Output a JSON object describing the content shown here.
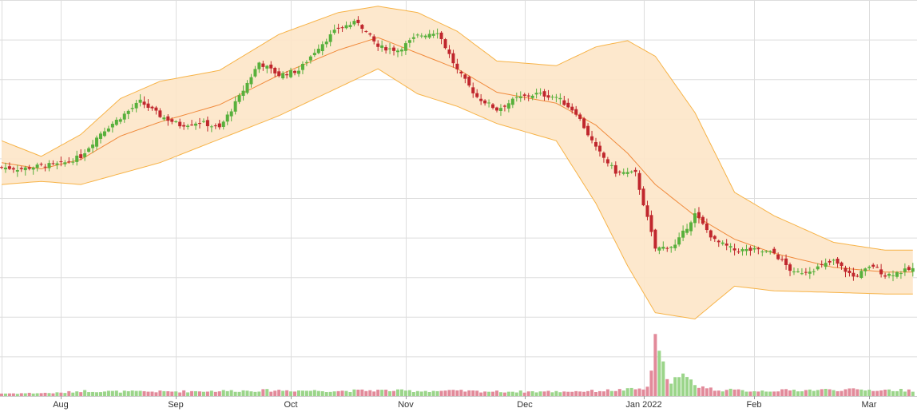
{
  "chart_data": {
    "type": "candlestick",
    "indicators": [
      "bollinger_bands",
      "moving_average",
      "volume"
    ],
    "x_tick_labels": [
      "Aug",
      "Sep",
      "Oct",
      "Nov",
      "Dec",
      "Jan 2022",
      "Feb",
      "Mar"
    ],
    "price_ylim": [
      30,
      270
    ],
    "volume_ylim": [
      0,
      100
    ],
    "grid": true,
    "legend": "none",
    "colors": {
      "up": "#58b03c",
      "down": "#c0272d",
      "band_fill": "#fde6c8",
      "band_line": "#f7b347",
      "ma_line": "#f08a3c",
      "volume_up": "#9bd58a",
      "volume_down": "#e28a9a",
      "grid": "#dddddd"
    },
    "anchors": {
      "close": [
        [
          0,
          163
        ],
        [
          5,
          162
        ],
        [
          10,
          164
        ],
        [
          15,
          165
        ],
        [
          20,
          170
        ],
        [
          25,
          185
        ],
        [
          30,
          195
        ],
        [
          35,
          205
        ],
        [
          40,
          196
        ],
        [
          45,
          190
        ],
        [
          50,
          192
        ],
        [
          55,
          188
        ],
        [
          60,
          208
        ],
        [
          65,
          230
        ],
        [
          70,
          222
        ],
        [
          75,
          225
        ],
        [
          80,
          240
        ],
        [
          85,
          252
        ],
        [
          90,
          256
        ],
        [
          95,
          240
        ],
        [
          100,
          238
        ],
        [
          105,
          247
        ],
        [
          110,
          250
        ],
        [
          115,
          225
        ],
        [
          120,
          208
        ],
        [
          125,
          200
        ],
        [
          130,
          207
        ],
        [
          135,
          210
        ],
        [
          140,
          208
        ],
        [
          145,
          198
        ],
        [
          150,
          175
        ],
        [
          155,
          160
        ],
        [
          160,
          159
        ],
        [
          165,
          111
        ],
        [
          170,
          113
        ],
        [
          175,
          133
        ],
        [
          180,
          116
        ],
        [
          185,
          110
        ],
        [
          190,
          110
        ],
        [
          195,
          108
        ],
        [
          200,
          95
        ],
        [
          205,
          98
        ],
        [
          210,
          103
        ],
        [
          215,
          93
        ],
        [
          220,
          100
        ],
        [
          223,
          94
        ],
        [
          230,
          98
        ]
      ],
      "mid": [
        [
          0,
          166
        ],
        [
          10,
          162
        ],
        [
          20,
          168
        ],
        [
          30,
          183
        ],
        [
          40,
          192
        ],
        [
          55,
          203
        ],
        [
          70,
          222
        ],
        [
          85,
          238
        ],
        [
          95,
          246
        ],
        [
          105,
          236
        ],
        [
          115,
          226
        ],
        [
          125,
          211
        ],
        [
          140,
          204
        ],
        [
          150,
          190
        ],
        [
          158,
          172
        ],
        [
          165,
          152
        ],
        [
          175,
          132
        ],
        [
          185,
          117
        ],
        [
          195,
          108
        ],
        [
          210,
          99
        ],
        [
          223,
          96
        ],
        [
          230,
          96
        ]
      ],
      "width": [
        [
          0,
          14
        ],
        [
          10,
          8
        ],
        [
          20,
          16
        ],
        [
          30,
          24
        ],
        [
          40,
          26
        ],
        [
          55,
          22
        ],
        [
          70,
          26
        ],
        [
          85,
          24
        ],
        [
          95,
          20
        ],
        [
          105,
          26
        ],
        [
          115,
          24
        ],
        [
          125,
          20
        ],
        [
          140,
          24
        ],
        [
          150,
          50
        ],
        [
          158,
          72
        ],
        [
          165,
          82
        ],
        [
          175,
          66
        ],
        [
          185,
          30
        ],
        [
          195,
          24
        ],
        [
          210,
          16
        ],
        [
          223,
          14
        ],
        [
          230,
          14
        ]
      ],
      "volume": [
        [
          0,
          4
        ],
        [
          15,
          5
        ],
        [
          20,
          8
        ],
        [
          30,
          7
        ],
        [
          40,
          7
        ],
        [
          55,
          8
        ],
        [
          70,
          9
        ],
        [
          85,
          8
        ],
        [
          95,
          9
        ],
        [
          105,
          8
        ],
        [
          115,
          8
        ],
        [
          125,
          7
        ],
        [
          140,
          7
        ],
        [
          150,
          8
        ],
        [
          158,
          10
        ],
        [
          163,
          12
        ],
        [
          165,
          80
        ],
        [
          167,
          45
        ],
        [
          169,
          25
        ],
        [
          172,
          30
        ],
        [
          176,
          16
        ],
        [
          180,
          10
        ],
        [
          190,
          8
        ],
        [
          200,
          9
        ],
        [
          210,
          10
        ],
        [
          230,
          9
        ]
      ]
    }
  }
}
